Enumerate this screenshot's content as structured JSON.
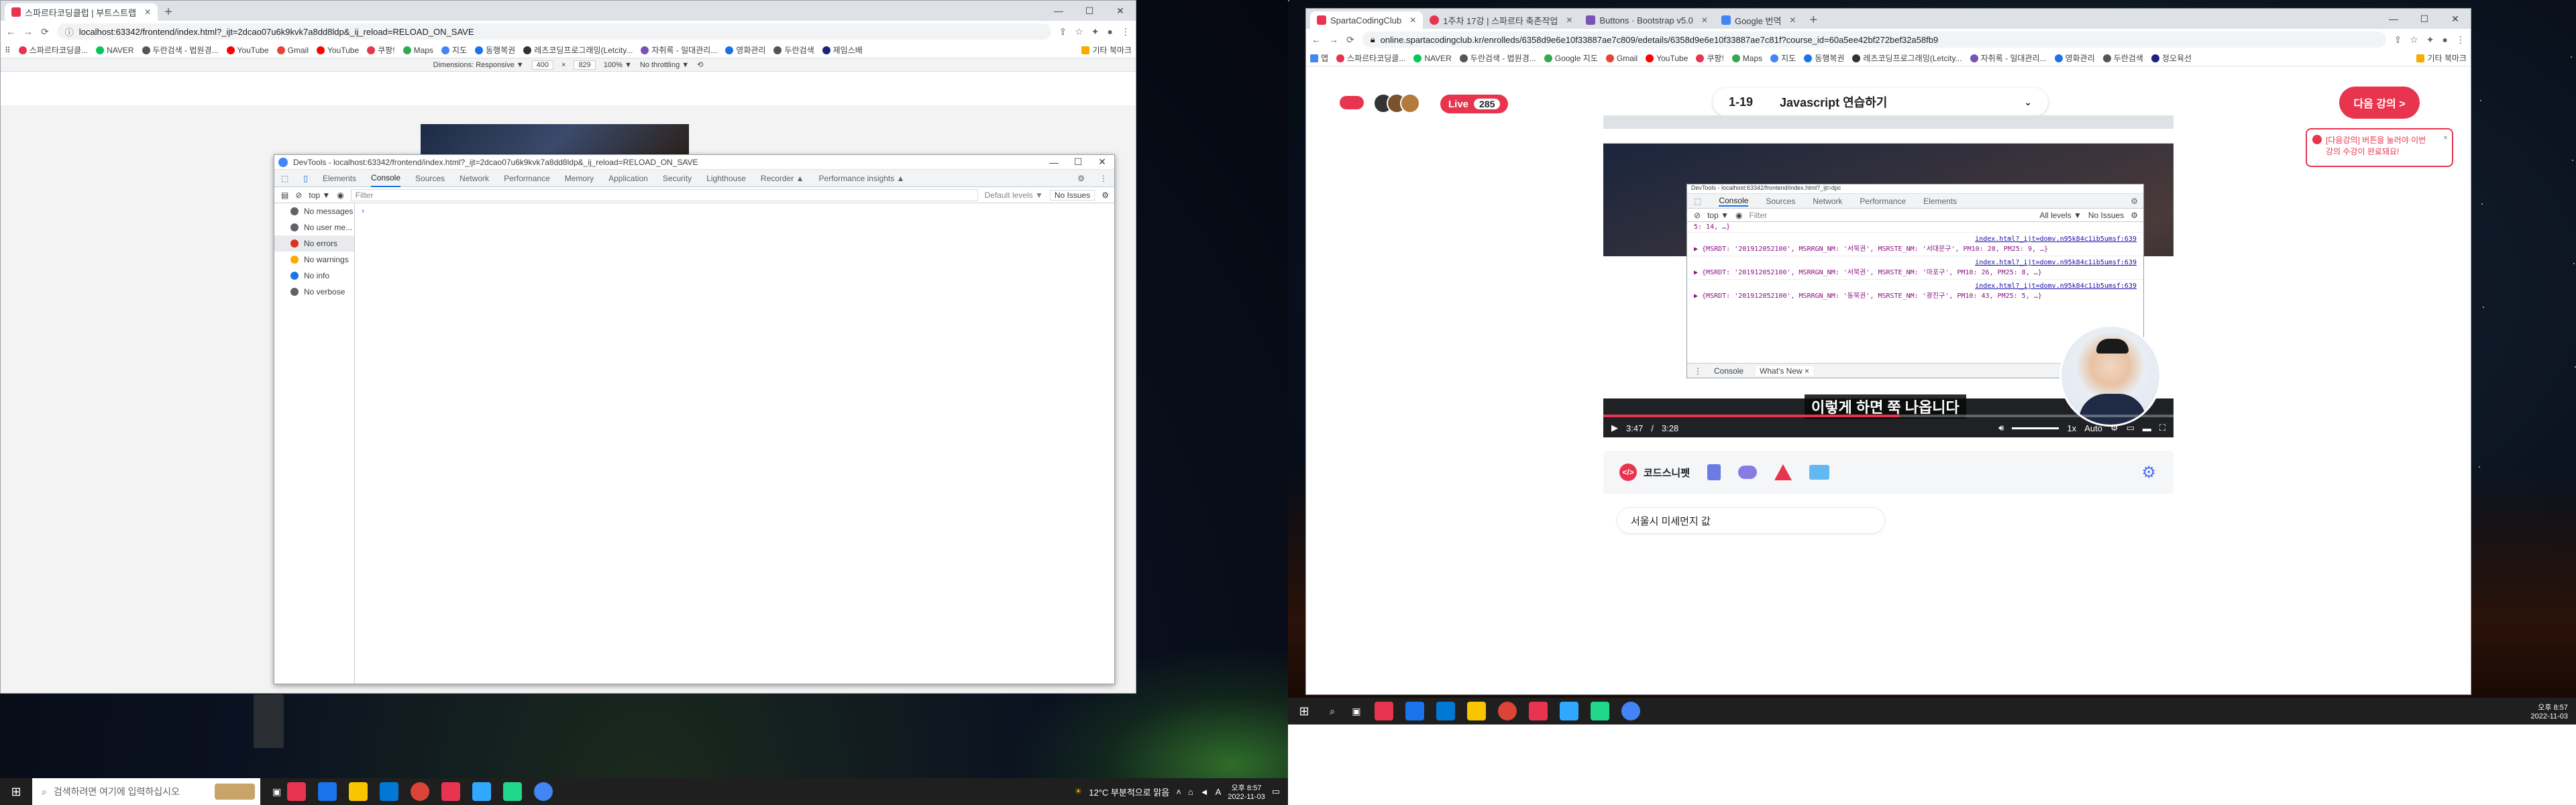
{
  "left_browser": {
    "tabs": [
      {
        "label": "스파르타코딩클럽 | 부트스트랩"
      }
    ],
    "url": "localhost:63342/frontend/index.html?_ijt=2dcao07u6k9kvk7a8dd8ldp&_ij_reload=RELOAD_ON_SAVE",
    "bookmarks": [
      "스파르타코딩클...",
      "NAVER",
      "두란검색 - 법원경...",
      "YouTube",
      "Gmail",
      "YouTube",
      "쿠팡!",
      "Maps",
      "지도",
      "동행복권",
      "레츠코딩프로그래밍(Letcity...",
      "자취록 - 일대관리...",
      "영화관리",
      "두란검색",
      "제임스배",
      "기타 북마크"
    ],
    "device_bar": {
      "dimensions": "Dimensions: Responsive ▼",
      "width": "400",
      "height": "829",
      "zoom": "100% ▼",
      "throttling": "No throttling ▼"
    }
  },
  "devtools": {
    "title": "DevTools - localhost:63342/frontend/index.html?_ijt=2dcao07u6k9kvk7a8dd8ldp&_ij_reload=RELOAD_ON_SAVE",
    "tabs": [
      "Elements",
      "Console",
      "Sources",
      "Network",
      "Performance",
      "Memory",
      "Application",
      "Security",
      "Lighthouse",
      "Recorder ▲",
      "Performance insights ▲"
    ],
    "context": "top ▼",
    "filter_placeholder": "Filter",
    "levels": "Default levels ▼",
    "issues": "No Issues",
    "sidebar": [
      {
        "label": "No messages",
        "color": "#5f6368"
      },
      {
        "label": "No user me...",
        "color": "#5f6368"
      },
      {
        "label": "No errors",
        "color": "#d93025"
      },
      {
        "label": "No warnings",
        "color": "#f9ab00"
      },
      {
        "label": "No info",
        "color": "#1a73e8"
      },
      {
        "label": "No verbose",
        "color": "#5f6368"
      }
    ],
    "prompt": "›"
  },
  "left_taskbar": {
    "search_placeholder": "검색하려면 여기에 입력하십시오",
    "weather": "12°C 부분적으로 맑음",
    "ime": "A",
    "time": "오후 8:57",
    "date": "2022-11-03"
  },
  "right_browser": {
    "tabs": [
      {
        "label": "SpartaCodingClub",
        "color": "#e8344e"
      },
      {
        "label": "1주차 17강 | 스파르타 축촌작업",
        "color": "#e8344e"
      },
      {
        "label": "Buttons · Bootstrap v5.0",
        "color": "#7952b3"
      },
      {
        "label": "Google 번역",
        "color": "#4285f4"
      }
    ],
    "url": "online.spartacodingclub.kr/enrolleds/6358d9e6e10f33887ae7c809/edetails/6358d9e6e10f33887ae7c81f?course_id=60a5ee42bf272bef32a58fb9",
    "bookmarks": [
      "앱",
      "스파르타코딩클...",
      "NAVER",
      "두란검색 - 법원경...",
      "Google 지도",
      "Gmail",
      "YouTube",
      "쿠팡!",
      "Maps",
      "지도",
      "동행복권",
      "레츠코딩프로그래밍(Letcity...",
      "자취록 - 일대관리...",
      "영화관리",
      "두란검색",
      "정오육선",
      "기타 북마크"
    ]
  },
  "lecture": {
    "live_label": "Live",
    "live_count": "285",
    "lesson_number": "1-19",
    "lesson_title": "Javascript 연습하기",
    "next_button": "다음 강의 >",
    "notice": "[다음강의] 버튼을 눌러야 이번 강의 수강이 완료돼요!",
    "subtitle": "이렇게 하면 쭉 나옵니다",
    "time_current": "3:47",
    "time_total": "3:28",
    "quality": "Auto",
    "speed": "1x",
    "progress": 0.52,
    "snippet_title": "코드스니펫",
    "snippet_item": "서울시 미세먼지 값"
  },
  "inner_devtools": {
    "title": "DevTools - localhost:63342/frontend/index.html?_ijt=dpc",
    "tabs": [
      "Console",
      "Sources",
      "Network",
      "Performance",
      "Elements"
    ],
    "context": "top ▼",
    "filter_placeholder": "Filter",
    "levels": "All levels ▼",
    "issues": "No Issues",
    "logs": [
      {
        "prefix": "5: 14, …}",
        "link": "",
        "text": ""
      },
      {
        "link": "index.html?_ijt=domv.n95k84c1ib5umsf:639",
        "text": "▶ {MSRDT: '201912052100', MSRRGN_NM: '서북권', MSRSTE_NM: '서대문구', PM10: 28, PM25: 9, …}"
      },
      {
        "link": "index.html?_ijt=domv.n95k84c1ib5umsf:639",
        "text": "▶ {MSRDT: '201912052100', MSRRGN_NM: '서북권', MSRSTE_NM: '마포구', PM10: 26, PM25: 8, …}"
      },
      {
        "link": "index.html?_ijt=domv.n95k84c1ib5umsf:639",
        "text": "▶ {MSRDT: '201912052100', MSRRGN_NM: '동북권', MSRSTE_NM: '광진구', PM10: 43, PM25: 5, …}"
      }
    ],
    "drawer_tabs": [
      "Console",
      "What's New ×"
    ]
  },
  "right_taskbar": {
    "time": "오후 8:57",
    "date": "2022-11-03"
  }
}
